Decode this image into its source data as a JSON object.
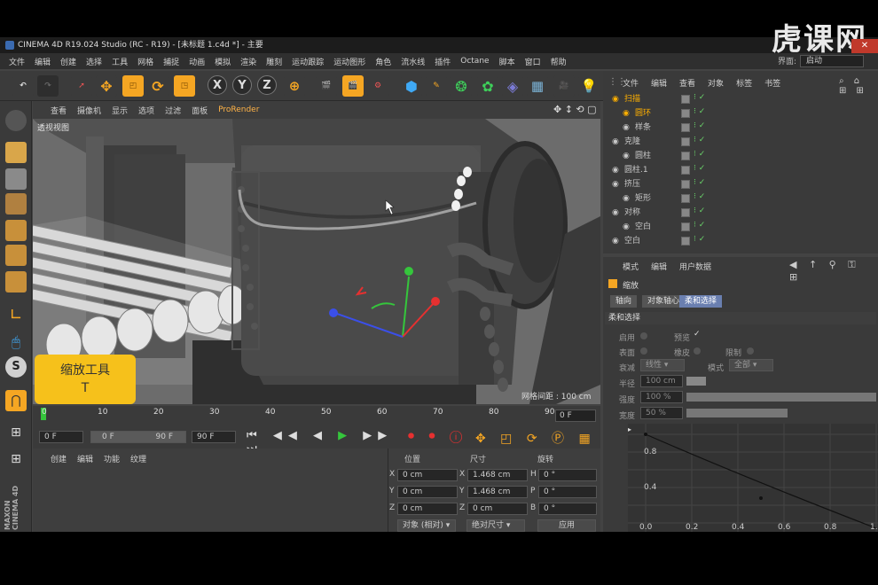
{
  "title": "CINEMA 4D R19.024 Studio (RC - R19) - [未标题 1.c4d *] - 主要",
  "watermark": "虎课网",
  "menu": [
    "文件",
    "编辑",
    "创建",
    "选择",
    "工具",
    "网格",
    "捕捉",
    "动画",
    "模拟",
    "渲染",
    "雕刻",
    "运动跟踪",
    "运动图形",
    "角色",
    "流水线",
    "插件",
    "Octane",
    "脚本",
    "窗口",
    "帮助"
  ],
  "layout": {
    "label": "界面:",
    "value": "启动"
  },
  "toolbar": {
    "axes": [
      "X",
      "Y",
      "Z"
    ]
  },
  "viewport": {
    "menu": [
      "查看",
      "摄像机",
      "显示",
      "选项",
      "过滤",
      "面板",
      "ProRender"
    ],
    "label": "透视视图",
    "grid_note": "网格间距 : 100 cm"
  },
  "tooltip": {
    "title": "缩放工具",
    "shortcut": "T"
  },
  "timeline": {
    "ticks": [
      "0",
      "10",
      "20",
      "30",
      "40",
      "50",
      "60",
      "70",
      "80",
      "90"
    ],
    "current": "0 F",
    "start": "0 F",
    "min": "0 F",
    "max": "90 F",
    "end": "90 F"
  },
  "material": {
    "menu": [
      "创建",
      "编辑",
      "功能",
      "纹理"
    ]
  },
  "coords": {
    "headers": [
      "位置",
      "尺寸",
      "旋转"
    ],
    "rows": [
      {
        "axis": "X",
        "pos": "0 cm",
        "size_axis": "X",
        "size": "1.468 cm",
        "rot_axis": "H",
        "rot": "0 °"
      },
      {
        "axis": "Y",
        "pos": "0 cm",
        "size_axis": "Y",
        "size": "1.468 cm",
        "rot_axis": "P",
        "rot": "0 °"
      },
      {
        "axis": "Z",
        "pos": "0 cm",
        "size_axis": "Z",
        "size": "0 cm",
        "rot_axis": "B",
        "rot": "0 °"
      }
    ],
    "mode": "对象 (相对)",
    "size_mode": "绝对尺寸",
    "apply": "应用"
  },
  "objects": {
    "menu": [
      "文件",
      "编辑",
      "查看",
      "对象",
      "标签",
      "书签"
    ],
    "rows": [
      {
        "name": "扫描",
        "indent": 0,
        "color": "#ffb000"
      },
      {
        "name": "圆环",
        "indent": 1,
        "color": "#ffb000"
      },
      {
        "name": "样条",
        "indent": 1,
        "color": "#c8c8c8"
      },
      {
        "name": "克隆",
        "indent": 0,
        "color": "#c8c8c8"
      },
      {
        "name": "圆柱",
        "indent": 1,
        "color": "#c8c8c8"
      },
      {
        "name": "圆柱.1",
        "indent": 0,
        "color": "#c8c8c8"
      },
      {
        "name": "挤压",
        "indent": 0,
        "color": "#c8c8c8"
      },
      {
        "name": "矩形",
        "indent": 1,
        "color": "#c8c8c8"
      },
      {
        "name": "对称",
        "indent": 0,
        "color": "#c8c8c8"
      },
      {
        "name": "空白",
        "indent": 1,
        "color": "#c8c8c8"
      },
      {
        "name": "空白",
        "indent": 0,
        "color": "#c8c8c8"
      }
    ]
  },
  "attributes": {
    "menu": [
      "模式",
      "编辑",
      "用户数据"
    ],
    "tool": "缩放",
    "tabs": [
      "轴向",
      "对象轴心",
      "柔和选择"
    ],
    "section": "柔和选择",
    "enable": "启用",
    "preview": "预览",
    "surface": "表面",
    "rubber": "橡皮",
    "restrict": "限制",
    "falloff_label": "衰减",
    "falloff": "线性",
    "mode_label": "模式",
    "mode": "全部",
    "radius_label": "半径",
    "radius": "100 cm",
    "strength_label": "强度",
    "strength": "100 %",
    "width_label": "宽度",
    "width": "50 %",
    "graph_y": [
      "0.8",
      "0.4"
    ],
    "graph_x": [
      "0.0",
      "0.2",
      "0.4",
      "0.6",
      "0.8",
      "1.0"
    ]
  }
}
